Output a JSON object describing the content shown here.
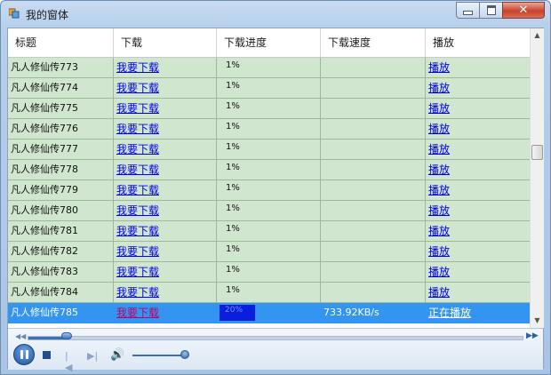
{
  "window": {
    "title": "我的窗体"
  },
  "grid": {
    "columns": [
      "标题",
      "下载",
      "下载进度",
      "下载速度",
      "播放"
    ],
    "rows": [
      {
        "title": "凡人修仙传773",
        "download": "我要下载",
        "progress": "1%",
        "speed": "",
        "play": "播放"
      },
      {
        "title": "凡人修仙传774",
        "download": "我要下载",
        "progress": "1%",
        "speed": "",
        "play": "播放"
      },
      {
        "title": "凡人修仙传775",
        "download": "我要下载",
        "progress": "1%",
        "speed": "",
        "play": "播放"
      },
      {
        "title": "凡人修仙传776",
        "download": "我要下载",
        "progress": "1%",
        "speed": "",
        "play": "播放"
      },
      {
        "title": "凡人修仙传777",
        "download": "我要下载",
        "progress": "1%",
        "speed": "",
        "play": "播放"
      },
      {
        "title": "凡人修仙传778",
        "download": "我要下载",
        "progress": "1%",
        "speed": "",
        "play": "播放"
      },
      {
        "title": "凡人修仙传779",
        "download": "我要下载",
        "progress": "1%",
        "speed": "",
        "play": "播放"
      },
      {
        "title": "凡人修仙传780",
        "download": "我要下载",
        "progress": "1%",
        "speed": "",
        "play": "播放"
      },
      {
        "title": "凡人修仙传781",
        "download": "我要下载",
        "progress": "1%",
        "speed": "",
        "play": "播放"
      },
      {
        "title": "凡人修仙传782",
        "download": "我要下载",
        "progress": "1%",
        "speed": "",
        "play": "播放"
      },
      {
        "title": "凡人修仙传783",
        "download": "我要下载",
        "progress": "1%",
        "speed": "",
        "play": "播放"
      },
      {
        "title": "凡人修仙传784",
        "download": "我要下载",
        "progress": "1%",
        "speed": "",
        "play": "播放"
      }
    ],
    "selected_row": {
      "title": "凡人修仙传785",
      "download": "我要下载",
      "progress": "20%",
      "progress_fraction": 0.2,
      "speed": "733.92KB/s",
      "play": "正在播放"
    },
    "scroll_fraction": 0.4
  },
  "player": {
    "seek_fraction": 0.08,
    "volume_fraction": 0.95,
    "icons": {
      "play_pause": "pause-icon",
      "stop": "stop-icon",
      "prev": "previous-icon",
      "next": "next-icon",
      "volume": "speaker-icon",
      "rewind": "rewind-icon",
      "fast_forward": "fast-forward-icon"
    }
  },
  "colors": {
    "row_bg": "#d0e6cf",
    "selected_bg": "#3395f0",
    "link": "#0000ee",
    "progress_fill": "#0a1ee0"
  }
}
